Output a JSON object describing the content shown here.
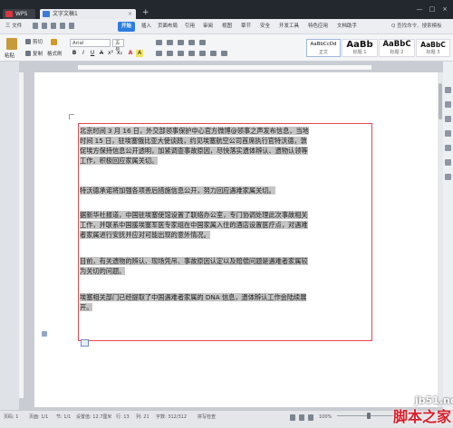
{
  "titlebar": {
    "tabs": [
      {
        "label": "WPS"
      },
      {
        "label": "文字文稿1"
      }
    ],
    "new_tab": "+"
  },
  "menubar": {
    "file": "三 文件",
    "items": [
      "开始",
      "插入",
      "页面布局",
      "引用",
      "审阅",
      "视图",
      "章节",
      "安全",
      "开发工具",
      "特色应用",
      "文档助手"
    ],
    "active": "开始",
    "search": "Q 查找命令、搜索模板"
  },
  "toolbar": {
    "paste": "粘贴",
    "cut": "剪切",
    "copy": "复制",
    "format_painter": "格式刷",
    "font": "Arial",
    "font_size": "五号",
    "format_buttons": [
      "B",
      "I",
      "U",
      "A",
      "x²",
      "x₂",
      "A",
      "A"
    ],
    "styles": [
      {
        "sample": "AaBbCcDd",
        "name": "正文"
      },
      {
        "sample": "AaBb",
        "name": "标题 1"
      },
      {
        "sample": "AaBbC",
        "name": "标题 2"
      },
      {
        "sample": "AaBbC",
        "name": "标题 3"
      }
    ]
  },
  "document": {
    "paragraphs": [
      [
        "北京时间 3 月 16 日，外交部领事保护中心官方微博@领事之声发布信息，当地",
        "时间 15 日，驻埃塞俄比亚大使谈践，约见埃塞航空公司首席执行官特沃德，敦",
        "促埃方保持信息公开透明，加紧调查事故原因，尽快落实遗体辨认、遗物认领等",
        "工作，积极回应家属关切。"
      ],
      [
        "特沃德承诺将加强各项善后措施信息公开，努力回应遇难家属关切。"
      ],
      [
        "据新华社报道，中国驻埃塞使馆设置了联络办公室，专门协调处理此次事故相关",
        "工作，并联系中国援埃塞军医专家组在中国家属入住的酒店设置医疗点，对遇难",
        "者家属进行安抚并应对可能出现的意外情况。"
      ],
      [
        "目前，有关遗物的辨认、现场凭吊、事故原因认定以及赔偿问题是遇难者家属较",
        "为关切的问题。"
      ],
      [
        "埃塞相关部门已经提取了中国遇难者家属的 DNA 信息，遗体辨认工作会陆续展",
        "开。"
      ]
    ]
  },
  "statusbar": {
    "page_num": "页码: 1",
    "pages": "页面: 1/1",
    "section": "节: 1/1",
    "setting": "设置值: 12.7厘米",
    "row": "行: 13",
    "col": "列: 21",
    "word_count": "字数: 312/312",
    "spell": "拼写检查",
    "zoom": "100%",
    "zoom_level": 100
  },
  "watermark": {
    "site": "jb51.net",
    "name": "脚本之家"
  },
  "colors": {
    "accent": "#2b7de0",
    "selection_border": "#e8454e",
    "selection_fill": "#c5c5c5"
  }
}
